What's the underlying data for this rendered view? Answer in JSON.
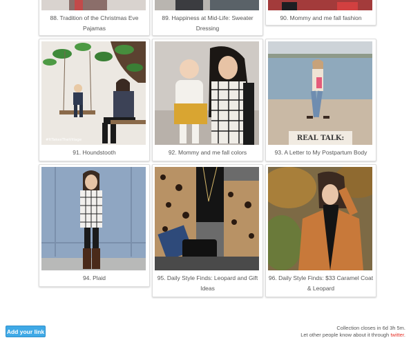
{
  "entries": [
    {
      "label": "88. Tradition of the Christmas Eve Pajamas",
      "photo": "christmas-pajamas-photo"
    },
    {
      "label": "89. Happiness at Mid-Life: Sweater Dressing",
      "photo": "sweater-dressing-photo"
    },
    {
      "label": "90. Mommy and me fall fashion",
      "photo": "mommy-me-fall-fashion-photo"
    },
    {
      "label": "91. Houndstooth",
      "photo": "houndstooth-photo",
      "overlay_text": "#ItTakesTheVillage"
    },
    {
      "label": "92. Mommy and me fall colors",
      "photo": "mommy-me-fall-colors-photo"
    },
    {
      "label": "93. A Letter to My Postpartum Body",
      "photo": "postpartum-letter-photo",
      "overlay_text": "REAL TALK:"
    },
    {
      "label": "94. Plaid",
      "photo": "plaid-photo"
    },
    {
      "label": "95. Daily Style Finds: Leopard and Gift Ideas",
      "photo": "leopard-gift-ideas-photo"
    },
    {
      "label": "96. Daily Style Finds: $33 Caramel Coat & Leopard",
      "photo": "caramel-coat-photo"
    }
  ],
  "add_link_button": "Add your link",
  "footer": {
    "closes_text": "Collection closes in 6d 3h 5m.",
    "share_text": "Let other people know about it through",
    "share_link": "twitter",
    "share_end": "."
  },
  "colors": {
    "button": "#3fa9e6",
    "link": "#e6332a",
    "caption": "#555555"
  }
}
